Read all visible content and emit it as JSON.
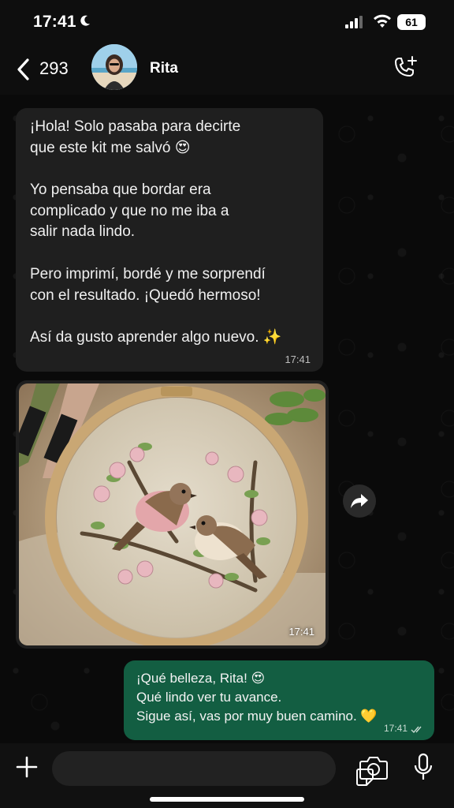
{
  "status_bar": {
    "time": "17:41",
    "battery": "61"
  },
  "header": {
    "back_count": "293",
    "contact_name": "Rita"
  },
  "messages": {
    "incoming_text": {
      "p1_line1": "¡Hola! Solo pasaba para decirte",
      "p1_line2": "que este kit me salvó 😍",
      "p2_line1": "Yo pensaba que bordar era",
      "p2_line2": "complicado y que no me iba a",
      "p2_line3": "salir nada lindo.",
      "p3_line1": "Pero imprimí, bordé y me sorprendí",
      "p3_line2": "con el resultado. ¡Quedó hermoso!",
      "p4_line1": "Así da gusto aprender algo nuevo. ✨",
      "time": "17:41"
    },
    "incoming_image": {
      "time": "17:41"
    },
    "outgoing": {
      "line1": "¡Qué belleza, Rita! 😍",
      "line2": "Qué lindo ver tu avance.",
      "line3": "Sigue así, vas por muy buen camino. 💛",
      "time": "17:41"
    }
  },
  "colors": {
    "incoming_bubble": "#1f1f1f",
    "outgoing_bubble": "#135e42"
  }
}
